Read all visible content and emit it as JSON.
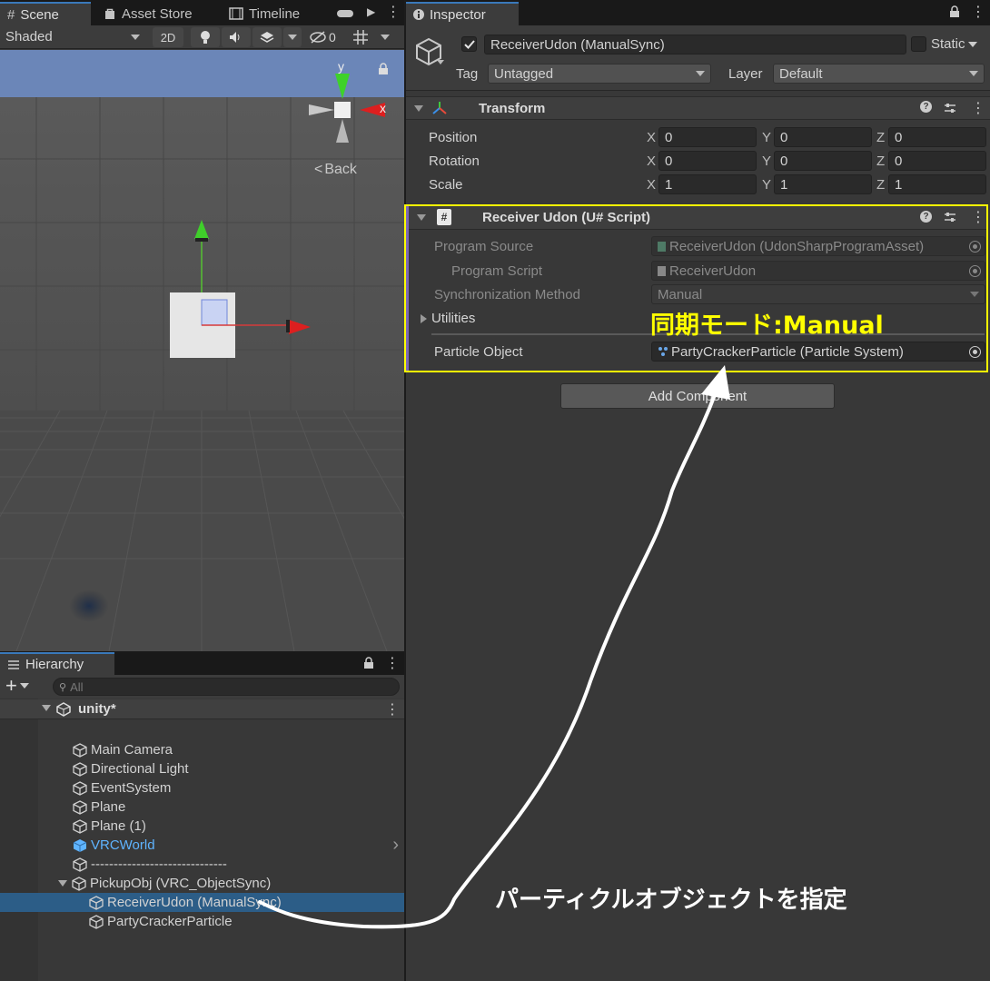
{
  "scene_tabs": {
    "scene": "Scene",
    "asset_store": "Asset Store",
    "timeline": "Timeline"
  },
  "scene_toolbar": {
    "shading": "Shaded",
    "mode_2d": "2D",
    "hidden_count": "0"
  },
  "gizmo": {
    "y_label": "y",
    "x_label": "x",
    "back_label": "Back"
  },
  "hierarchy": {
    "tab": "Hierarchy",
    "search_placeholder": "All",
    "scene_name": "unity*",
    "items": [
      {
        "label": "Main Camera"
      },
      {
        "label": "Directional Light"
      },
      {
        "label": "EventSystem"
      },
      {
        "label": "Plane"
      },
      {
        "label": "Plane (1)"
      },
      {
        "label": "VRCWorld"
      },
      {
        "label": "------------------------------"
      },
      {
        "label": "PickupObj (VRC_ObjectSync)"
      },
      {
        "label": "ReceiverUdon (ManualSync)"
      },
      {
        "label": "PartyCrackerParticle"
      }
    ]
  },
  "inspector": {
    "tab": "Inspector",
    "object_name": "ReceiverUdon (ManualSync)",
    "static_label": "Static",
    "tag_label": "Tag",
    "tag_value": "Untagged",
    "layer_label": "Layer",
    "layer_value": "Default",
    "transform": {
      "title": "Transform",
      "rows": [
        {
          "label": "Position",
          "x": "0",
          "y": "0",
          "z": "0"
        },
        {
          "label": "Rotation",
          "x": "0",
          "y": "0",
          "z": "0"
        },
        {
          "label": "Scale",
          "x": "1",
          "y": "1",
          "z": "1"
        }
      ],
      "axis_x": "X",
      "axis_y": "Y",
      "axis_z": "Z"
    },
    "udon": {
      "title": "Receiver Udon (U# Script)",
      "program_source_label": "Program Source",
      "program_source_value": "ReceiverUdon (UdonSharpProgramAsset)",
      "program_script_label": "Program Script",
      "program_script_value": "ReceiverUdon",
      "sync_label": "Synchronization Method",
      "sync_value": "Manual",
      "utilities_label": "Utilities",
      "particle_label": "Particle Object",
      "particle_value": "PartyCrackerParticle (Particle System)"
    },
    "add_component": "Add Component"
  },
  "annotations": {
    "sync_mode": "同期モード:Manual",
    "specify_particle": "パーティクルオブジェクトを指定"
  },
  "colors": {
    "highlight_yellow": "#ffff00",
    "selection_blue": "#2c5d87",
    "accent_blue": "#3a79bb"
  }
}
